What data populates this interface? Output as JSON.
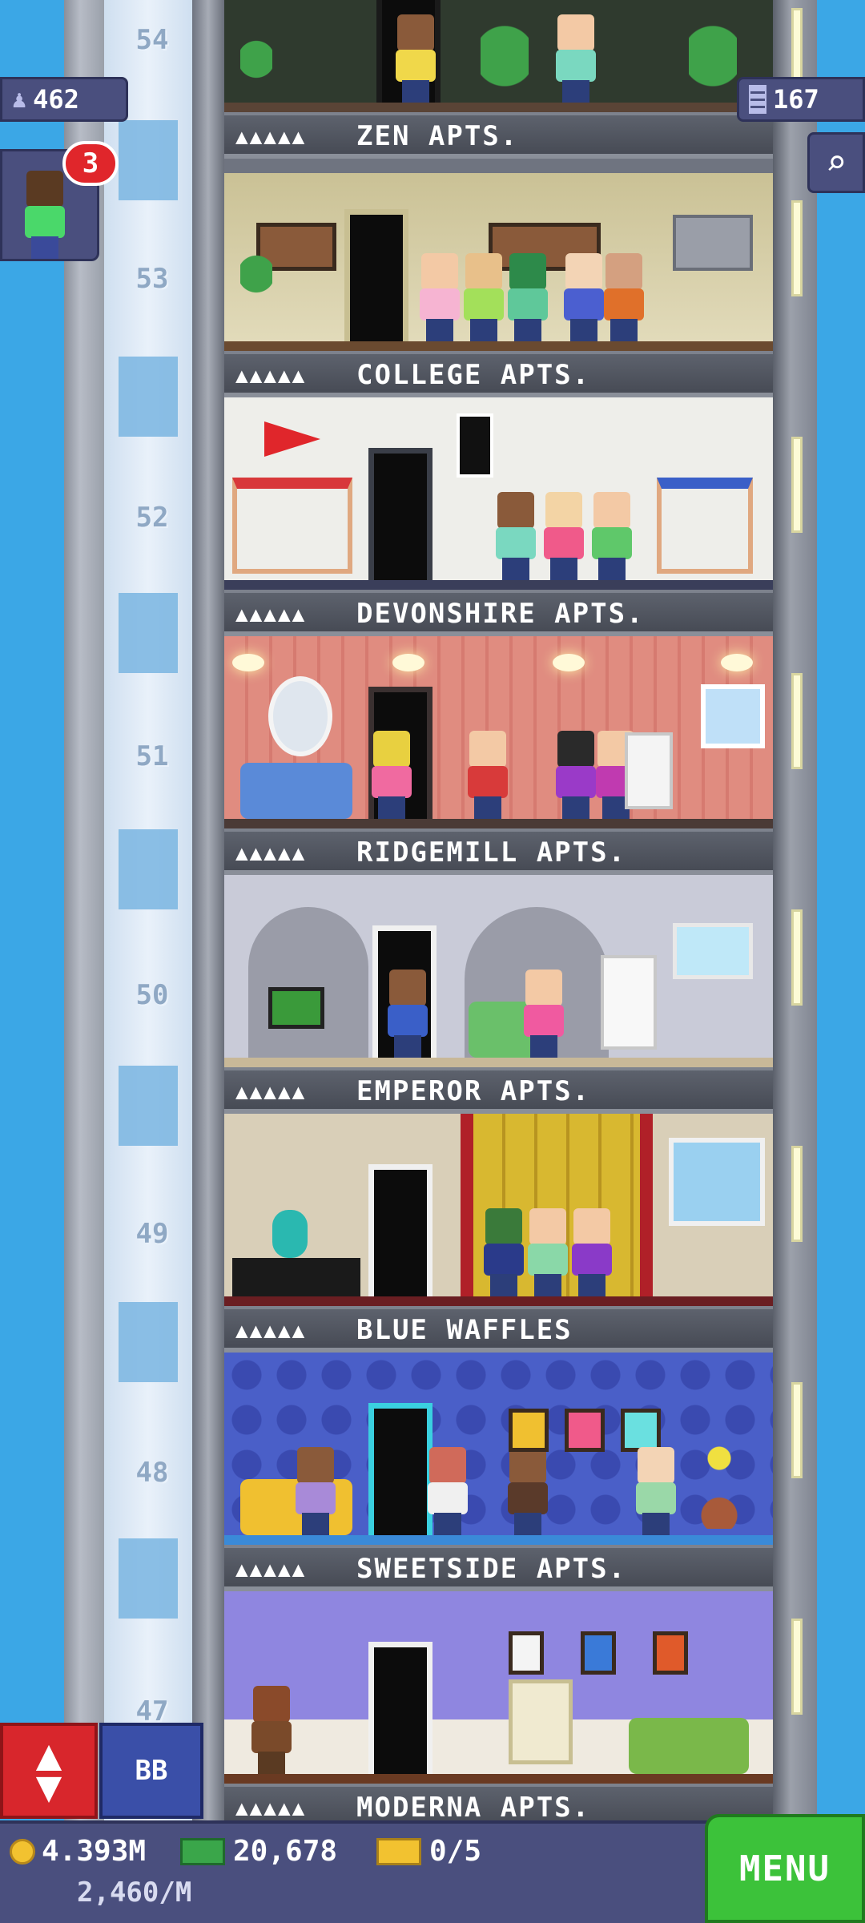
{
  "hud": {
    "population": "462",
    "floors_count": "167",
    "notification_count": "3",
    "bb_label": "BB",
    "menu_label": "MENU",
    "coins": "4.393M",
    "bux": "20,678",
    "vip": "0/5",
    "income_rate": "2,460/M"
  },
  "floor_numbers": [
    "54",
    "53",
    "52",
    "51",
    "50",
    "49",
    "48",
    "47"
  ],
  "floors": [
    {
      "name": "ZEN APTS.",
      "stars": "▲▲▲▲▲",
      "color": "#2f3a2e"
    },
    {
      "name": "COLLEGE APTS.",
      "stars": "▲▲▲▲▲",
      "color": "#d6cfa8"
    },
    {
      "name": "DEVONSHIRE APTS.",
      "stars": "▲▲▲▲▲",
      "color": "#eeeeea"
    },
    {
      "name": "RIDGEMILL APTS.",
      "stars": "▲▲▲▲▲",
      "color": "#e08c80"
    },
    {
      "name": "EMPEROR APTS.",
      "stars": "▲▲▲▲▲",
      "color": "#c9cbd8"
    },
    {
      "name": "BLUE WAFFLES",
      "stars": "▲▲▲▲▲",
      "color": "#d9cfb8"
    },
    {
      "name": "SWEETSIDE APTS.",
      "stars": "▲▲▲▲▲",
      "color": "#4a5fc8"
    },
    {
      "name": "MODERNA APTS.",
      "stars": "▲▲▲▲▲",
      "color": "#8f86e0"
    }
  ],
  "icons": {
    "population": "person-icon",
    "floors": "building-icon",
    "search": "magnifier-icon",
    "elevator": "up-down-arrows-icon",
    "coins": "coin-icon",
    "bux": "tower-bux-icon",
    "vip": "vip-ticket-icon"
  }
}
